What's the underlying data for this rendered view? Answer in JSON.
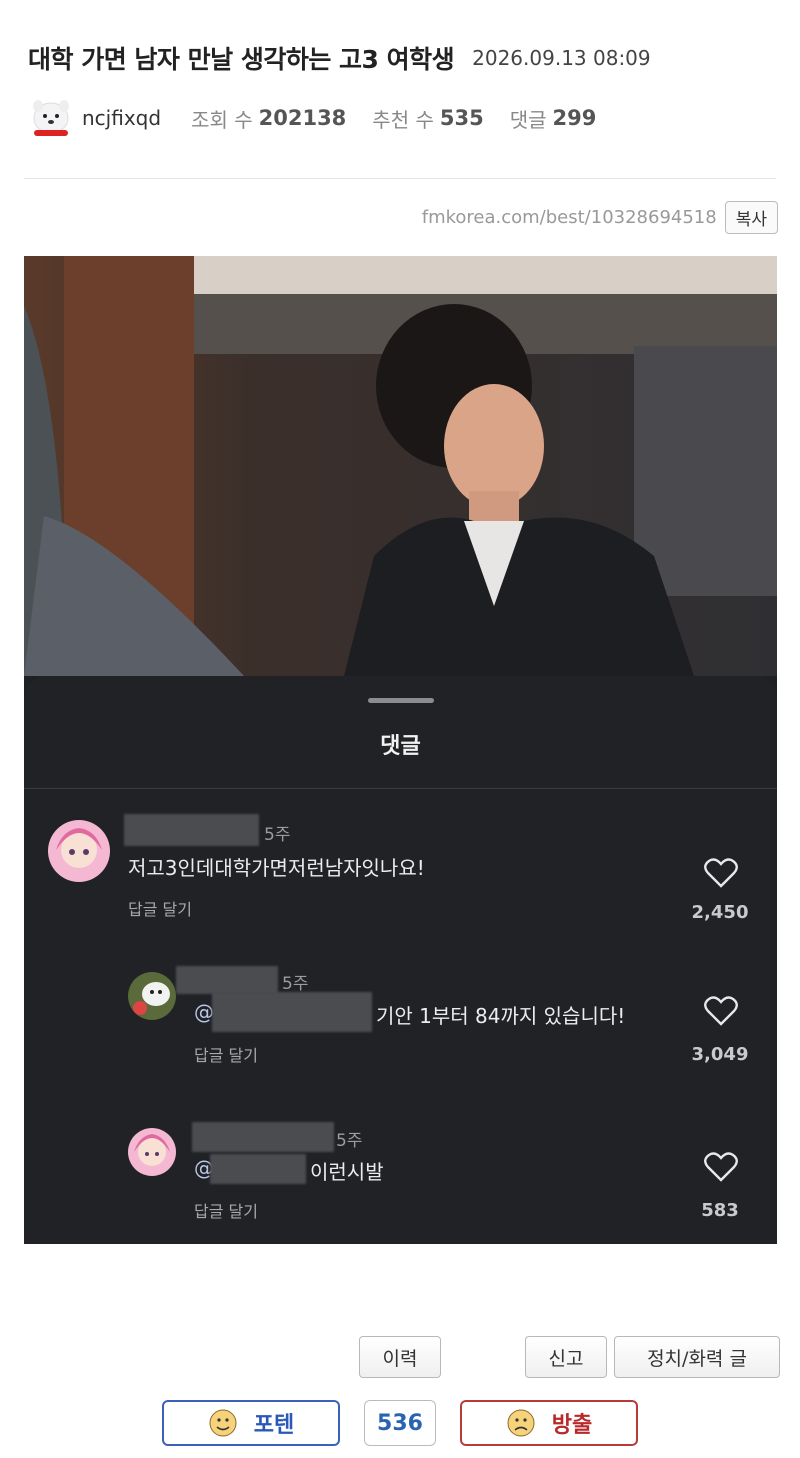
{
  "post": {
    "title": "대학 가면 남자 만날 생각하는 고3 여학생",
    "date": "2026.09.13 08:09",
    "author": "ncjfixqd",
    "views_label": "조회 수",
    "views": "202138",
    "recommend_label": "추천 수",
    "recommend": "535",
    "comments_label": "댓글",
    "comments": "299",
    "url": "fmkorea.com/best/10328694518",
    "copy_label": "복사"
  },
  "sheet": {
    "title": "댓글",
    "comments": [
      {
        "time": "5주",
        "text": "저고3인데대학가면저런남자잇나요!",
        "reply_label": "답글 달기",
        "likes": "2,450"
      },
      {
        "time": "5주",
        "mention": "@",
        "text": "기안 1부터 84까지 있습니다!",
        "reply_label": "답글 달기",
        "likes": "3,049"
      },
      {
        "time": "5주",
        "mention": "@",
        "text": "이런시발",
        "reply_label": "답글 달기",
        "likes": "583"
      }
    ]
  },
  "actions": {
    "history_label": "이력",
    "report_label": "신고",
    "politics_label": "정치/화력 글"
  },
  "vote": {
    "up_label": "포텐",
    "count": "536",
    "down_label": "방출"
  },
  "colors": {
    "vote_up": "#2a58b8",
    "vote_down": "#b82a2a",
    "sheet_bg": "#202226"
  }
}
